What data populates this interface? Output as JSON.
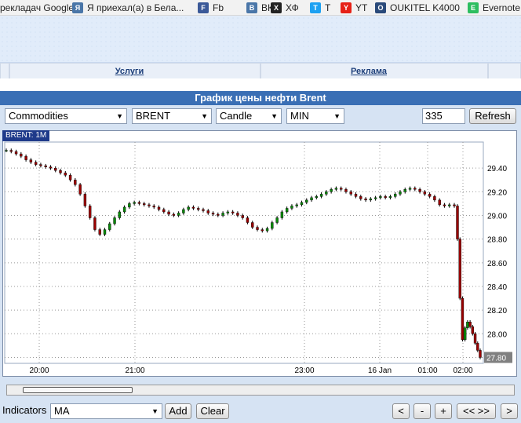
{
  "bookmarks": [
    {
      "label": "реклaдач Google",
      "icon": "google-translate-icon",
      "color": "#f2f2f2"
    },
    {
      "label": "Я приехал(а) в Бела...",
      "icon": "vk-icon",
      "color": "#4a76a8"
    },
    {
      "label": "Fb",
      "icon": "facebook-icon",
      "color": "#3b5998"
    },
    {
      "label": "ВК",
      "icon": "vk-icon",
      "color": "#4a76a8"
    },
    {
      "label": "ХФ",
      "icon": "xf-icon",
      "color": "#222222"
    },
    {
      "label": "T",
      "icon": "twitter-icon",
      "color": "#1da1f2"
    },
    {
      "label": "YT",
      "icon": "youtube-icon",
      "color": "#e62117"
    },
    {
      "label": "OUKITEL K4000",
      "icon": "oukitel-icon",
      "color": "#2a4a7a"
    },
    {
      "label": "Evernote",
      "icon": "evernote-icon",
      "color": "#2dbe60"
    }
  ],
  "nav": {
    "services": "Услуги",
    "ads": "Реклама"
  },
  "title": "График цены нефти Brent",
  "controls": {
    "market": "Commodities",
    "symbol": "BRENT",
    "chart_type": "Candle",
    "period": "MIN",
    "bars": "335",
    "refresh": "Refresh"
  },
  "chart_tab": "BRENT: 1M",
  "bottom": {
    "indicators_label": "Indicators",
    "indicator": "MA",
    "add": "Add",
    "clear": "Clear",
    "nav_buttons": [
      "<",
      "-",
      "+",
      "<< >>",
      ">"
    ]
  },
  "colors": {
    "up": "#0a8a0a",
    "down": "#9a0000",
    "accent": "#3a6fb5"
  },
  "chart_data": {
    "type": "line",
    "title": "",
    "x_ticks": [
      "20:00",
      "21:00",
      "23:00",
      "16 Jan",
      "01:00",
      "02:00"
    ],
    "y_ticks": [
      "29.40",
      "29.20",
      "29.00",
      "28.80",
      "28.60",
      "28.40",
      "28.20",
      "28.00",
      "27.80"
    ],
    "ylim": [
      27.75,
      29.62
    ],
    "last_price": "27.80",
    "grid": true,
    "series": [
      {
        "values": [
          29.55,
          29.54,
          29.52,
          29.5,
          29.47,
          29.45,
          29.43,
          29.42,
          29.41,
          29.4,
          29.38,
          29.36,
          29.34,
          29.3,
          29.26,
          29.18,
          29.08,
          28.98,
          28.88,
          28.84,
          28.88,
          28.93,
          28.98,
          29.03,
          29.07,
          29.1,
          29.11,
          29.1,
          29.09,
          29.08,
          29.07,
          29.05,
          29.03,
          29.01,
          29.0,
          29.02,
          29.05,
          29.07,
          29.06,
          29.05,
          29.04,
          29.02,
          29.01,
          29.0,
          29.02,
          29.03,
          29.02,
          29.0,
          28.98,
          28.94,
          28.9,
          28.88,
          28.87,
          28.89,
          28.94,
          28.98,
          29.03,
          29.06,
          29.08,
          29.09,
          29.11,
          29.13,
          29.15,
          29.16,
          29.18,
          29.2,
          29.22,
          29.23,
          29.22,
          29.2,
          29.18,
          29.16,
          29.14,
          29.13,
          29.14,
          29.15,
          29.16,
          29.15,
          29.16,
          29.18,
          29.2,
          29.22,
          29.23,
          29.22,
          29.2,
          29.18,
          29.16,
          29.13,
          29.09,
          29.08,
          29.09,
          29.08,
          28.8,
          28.3,
          27.95,
          28.05,
          28.1,
          28.06,
          28.0,
          27.92,
          27.86,
          27.8
        ]
      }
    ]
  }
}
